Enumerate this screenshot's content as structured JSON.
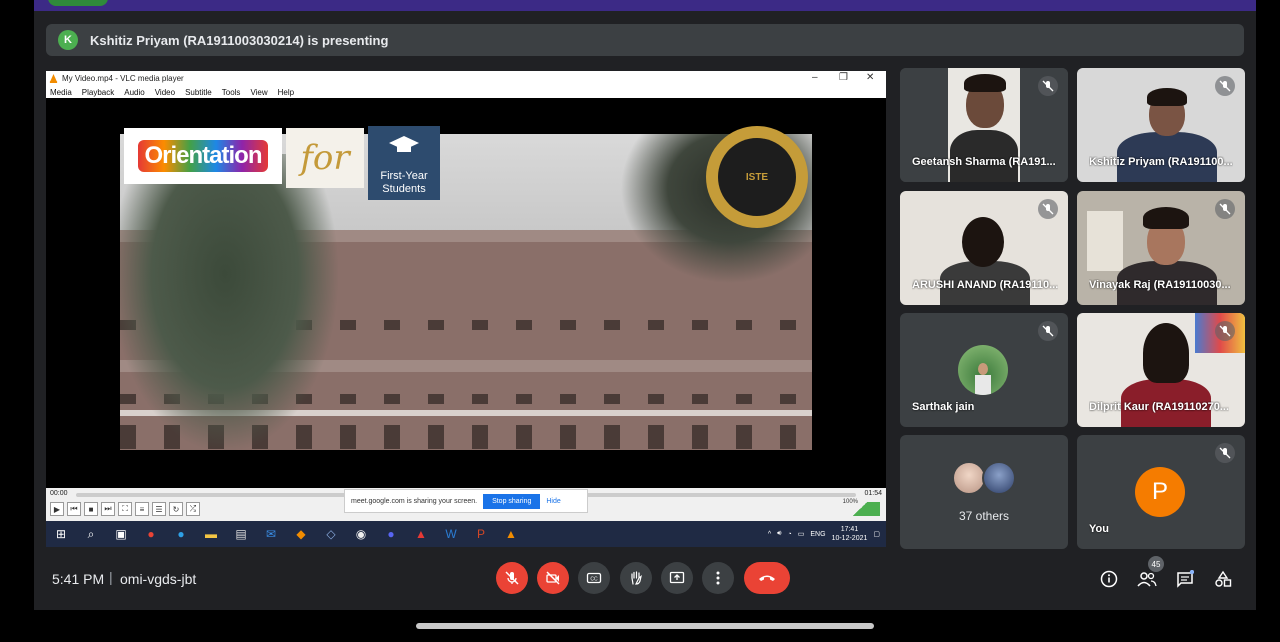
{
  "presenter_bar": {
    "avatar_letter": "K",
    "text": "Kshitiz Priyam (RA1911003030214) is presenting"
  },
  "vlc": {
    "title": "My Video.mp4 - VLC media player",
    "menu": [
      "Media",
      "Playback",
      "Audio",
      "Video",
      "Subtitle",
      "Tools",
      "View",
      "Help"
    ],
    "time_elapsed": "00:00",
    "time_total": "01:54",
    "volume": "100%",
    "banner_orientation": "Orientation",
    "banner_for": "for",
    "banner_first_year": "First-Year Students",
    "logo_text": "ISTE"
  },
  "share_notice": {
    "text": "meet.google.com is sharing your screen.",
    "stop_label": "Stop sharing",
    "hide_label": "Hide"
  },
  "taskbar": {
    "lang": "ENG",
    "time": "17:41",
    "date": "10-12-2021"
  },
  "participants": [
    {
      "name": "Geetansh Sharma (RA191...",
      "muted": true
    },
    {
      "name": "Kshitiz Priyam (RA191100...",
      "muted": true
    },
    {
      "name": "ARUSHI ANAND (RA19110...",
      "muted": true
    },
    {
      "name": "Vinayak Raj (RA19110030...",
      "muted": true
    },
    {
      "name": "Sarthak jain",
      "muted": true
    },
    {
      "name": "Dilprit Kaur (RA19110270...",
      "muted": true
    }
  ],
  "others_tile": {
    "label": "37 others"
  },
  "you_tile": {
    "label": "You",
    "avatar_letter": "P"
  },
  "bottom_bar": {
    "time": "5:41 PM",
    "separator": "|",
    "meeting_code": "omi-vgds-jbt",
    "people_count": "45"
  },
  "colors": {
    "background": "#202124",
    "tile": "#3c4043",
    "danger": "#ea4335",
    "you_avatar": "#f57c00"
  }
}
